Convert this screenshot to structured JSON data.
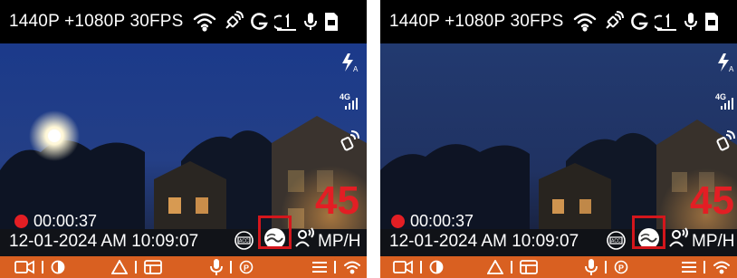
{
  "screens": [
    {
      "status": {
        "resolution": "1440P +1080P 30FPS"
      },
      "overlay": {
        "rec_time": "00:00:37",
        "datetime": "12-01-2024 AM 10:09:07"
      },
      "speed": {
        "value": "45",
        "unit": "MP/H"
      }
    },
    {
      "status": {
        "resolution": "1440P +1080P 30FPS"
      },
      "overlay": {
        "rec_time": "00:00:37",
        "datetime": "12-01-2024 AM 10:09:07"
      },
      "speed": {
        "value": "45",
        "unit": "MP/H"
      }
    }
  ],
  "icons": {
    "status_bar": [
      "wifi-icon",
      "gps-satellite-icon",
      "g-sensor-icon",
      "loop-recording-icon",
      "microphone-icon",
      "sd-card-icon"
    ],
    "right_column": [
      "flash-auto-icon",
      "4g-signal-icon",
      "gps-icon"
    ],
    "overlay": [
      "acc-icon",
      "lane-assist-icon",
      "driver-alert-icon"
    ],
    "bottom_bar": [
      "video-camera-icon",
      "lens-switch-icon",
      "triangle-alert-icon",
      "screen-icon",
      "microphone-button-icon",
      "parking-icon",
      "menu-icon",
      "wifi-button-icon"
    ]
  },
  "colors": {
    "accent_orange": "#d96021",
    "record_red": "#e31e24",
    "highlight_red": "#d4161c",
    "status_bg": "#000000"
  }
}
